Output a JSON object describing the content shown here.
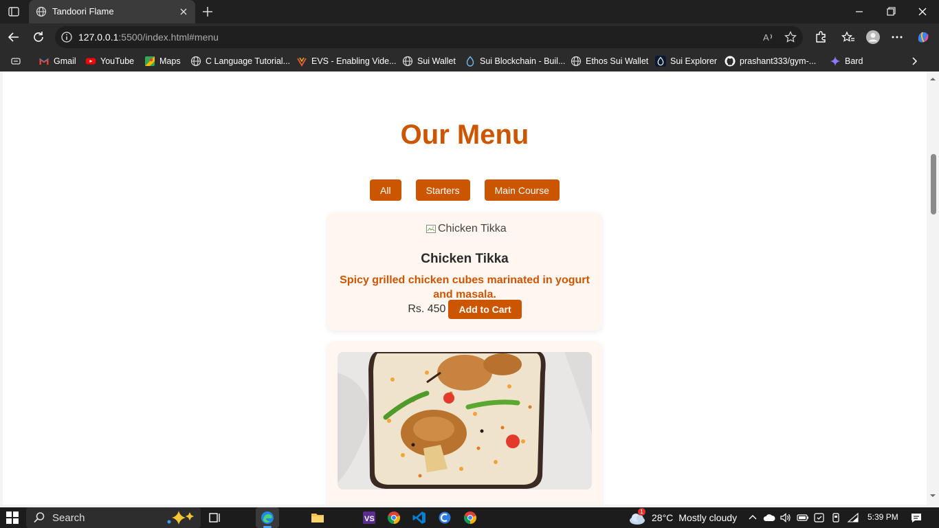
{
  "browser": {
    "tab_title": "Tandoori Flame",
    "url_host": "127.0.0.1",
    "url_rest": ":5500/index.html#menu",
    "bookmarks": [
      {
        "label": "Gmail",
        "icon": "gmail-icon"
      },
      {
        "label": "YouTube",
        "icon": "youtube-icon"
      },
      {
        "label": "Maps",
        "icon": "maps-icon"
      },
      {
        "label": "C Language Tutorial...",
        "icon": "globe-icon"
      },
      {
        "label": "EVS - Enabling Vide...",
        "icon": "evs-icon"
      },
      {
        "label": "Sui Wallet",
        "icon": "globe-icon"
      },
      {
        "label": "Sui Blockchain - Buil...",
        "icon": "sui-drop-icon"
      },
      {
        "label": "Ethos Sui Wallet",
        "icon": "globe-icon"
      },
      {
        "label": "Sui Explorer",
        "icon": "sui-drop-icon"
      },
      {
        "label": "prashant333/gym-...",
        "icon": "github-icon"
      },
      {
        "label": "Bard",
        "icon": "bard-sparkle-icon"
      }
    ]
  },
  "page": {
    "title": "Our Menu",
    "filters": [
      "All",
      "Starters",
      "Main Course"
    ],
    "items": [
      {
        "image_alt": "Chicken Tikka",
        "name": "Chicken Tikka",
        "description": "Spicy grilled chicken cubes marinated in yogurt and masala.",
        "price": "Rs. 450",
        "cart_label": "Add to Cart"
      }
    ]
  },
  "taskbar": {
    "search_label": "Search",
    "weather_temp": "28°C",
    "weather_condition": "Mostly cloudy",
    "weather_badge": "1",
    "time": "5:39 PM"
  },
  "colors": {
    "accent": "#cc5500",
    "card_bg": "#fff6f0"
  }
}
